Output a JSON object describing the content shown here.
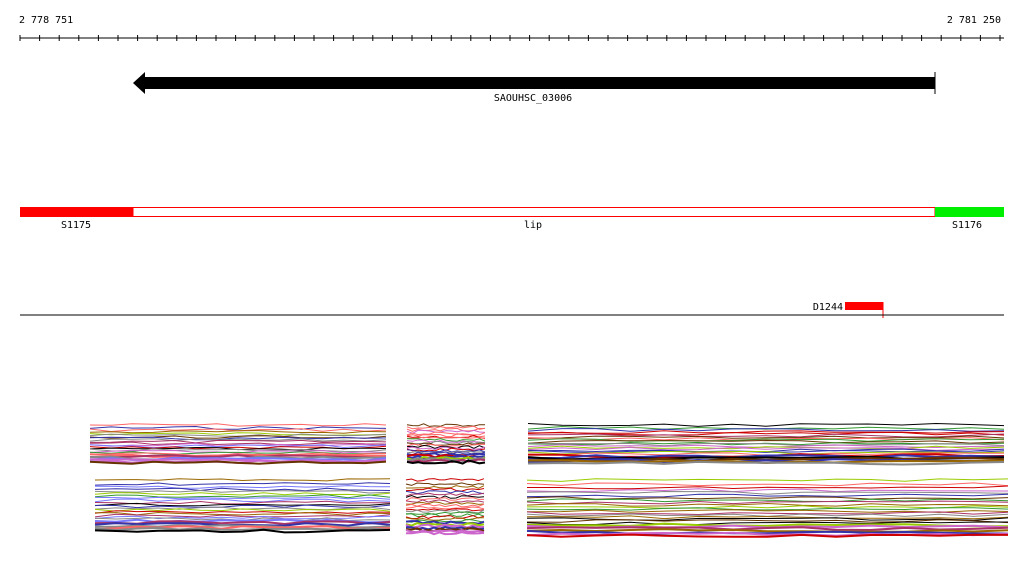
{
  "ruler": {
    "start_label": "2 778 751",
    "end_label": "2 781 250"
  },
  "gene": {
    "name": "SAOUHSC_03006",
    "direction": "reverse",
    "color": "#000000"
  },
  "segments": [
    {
      "label": "S1175",
      "color": "#ff0000"
    },
    {
      "label": "lip",
      "color": "#ffffff",
      "border": "#ff0000"
    },
    {
      "label": "S1176",
      "color": "#00ee00"
    }
  ],
  "marker": {
    "label": "D1244",
    "color": "#ff0000"
  },
  "expression": {
    "palette": [
      "#000000",
      "#cc0000",
      "#ff6666",
      "#3333aa",
      "#7777ff",
      "#996600",
      "#339933",
      "#99cc00",
      "#cc66cc",
      "#663300",
      "#aa3366",
      "#888888"
    ]
  }
}
